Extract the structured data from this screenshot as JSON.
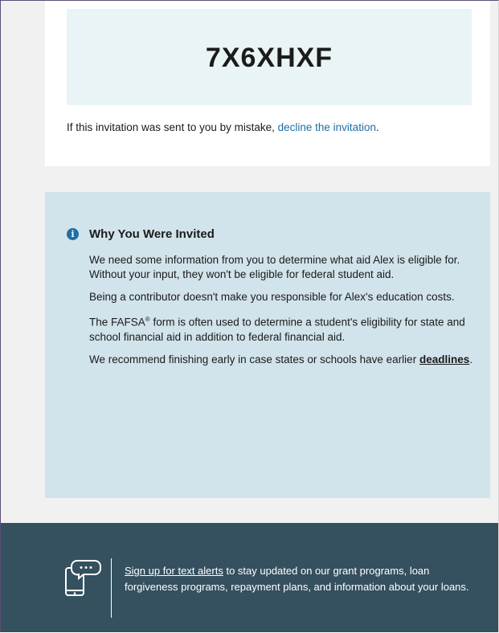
{
  "invitation": {
    "code": "7X6XHXF",
    "mistake_prefix": "If this invitation was sent to you by mistake, ",
    "decline_link": "decline the invitation",
    "mistake_suffix": "."
  },
  "why_invited": {
    "icon": "info-icon",
    "heading": "Why You Were Invited",
    "paragraphs": [
      "We need some information from you to determine what aid Alex is eligible for. Without your input, they won't be eligible for federal student aid.",
      "Being a contributor doesn't make you responsible for Alex's education costs."
    ],
    "fafsa_prefix": "The FAFSA",
    "fafsa_reg": "®",
    "fafsa_suffix": " form is often used to determine a student's eligibility for state and school financial aid in addition to federal financial aid.",
    "recommend_prefix": "We recommend finishing early in case states or schools have earlier ",
    "deadlines_link": "deadlines",
    "recommend_suffix": "."
  },
  "footer": {
    "icon": "phone-chat-icon",
    "signup_link": "Sign up for text alerts",
    "signup_text": " to stay updated on our grant programs, loan forgiveness programs, repayment plans, and information about your loans."
  },
  "colors": {
    "code_box_bg": "#e9f4f7",
    "info_bg": "#d1e3eb",
    "link": "#1f6fa3",
    "footer_bg": "#35505f",
    "page_bg": "#f1f1f1"
  }
}
